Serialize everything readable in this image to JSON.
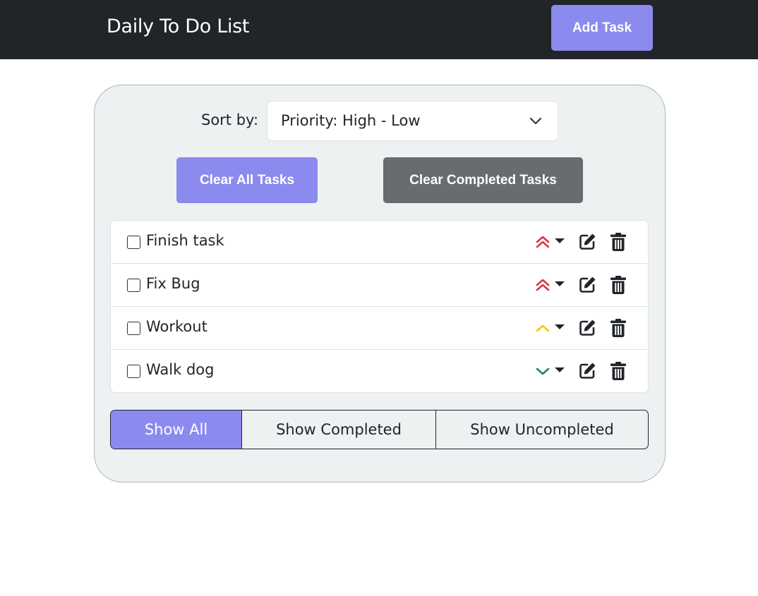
{
  "header": {
    "title": "Daily To Do List",
    "add_task_label": "Add Task"
  },
  "sort": {
    "label": "Sort by:",
    "selected": "Priority: High - Low"
  },
  "actions": {
    "clear_all_label": "Clear All Tasks",
    "clear_completed_label": "Clear Completed Tasks"
  },
  "tasks": [
    {
      "name": "Finish task",
      "priority": "high",
      "completed": false
    },
    {
      "name": "Fix Bug",
      "priority": "high",
      "completed": false
    },
    {
      "name": "Workout",
      "priority": "medium",
      "completed": false
    },
    {
      "name": "Walk dog",
      "priority": "low",
      "completed": false
    }
  ],
  "filters": {
    "show_all": "Show All",
    "show_completed": "Show Completed",
    "show_uncompleted": "Show Uncompleted",
    "active": "show_all"
  },
  "colors": {
    "accent": "#8b8aef",
    "navbar": "#212529",
    "secondary": "#686c6f",
    "priority_high": "#dc3545",
    "priority_medium": "#ffc107",
    "priority_low": "#198754"
  }
}
